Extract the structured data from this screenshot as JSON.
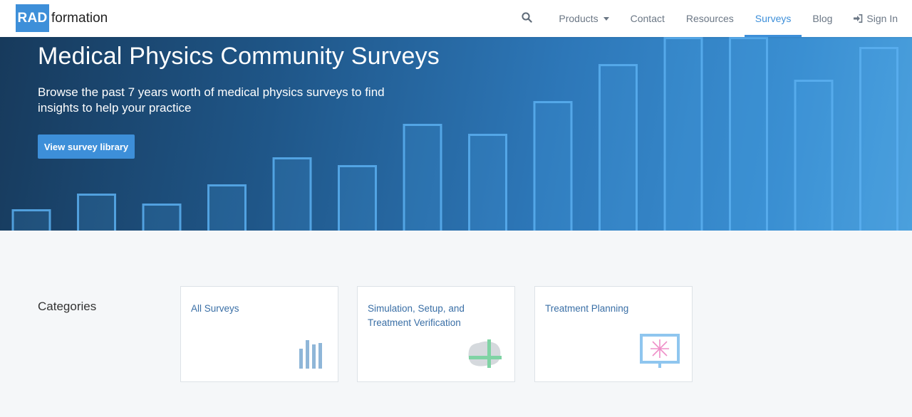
{
  "brand": {
    "logo_mark": "RAD",
    "logo_text": "formation",
    "accent": "#3d8fd9"
  },
  "nav": {
    "search_icon": "search-icon",
    "items": [
      {
        "label": "Products",
        "has_dropdown": true
      },
      {
        "label": "Contact"
      },
      {
        "label": "Resources"
      },
      {
        "label": "Surveys",
        "active": true
      },
      {
        "label": "Blog"
      }
    ],
    "signin": {
      "label": "Sign In",
      "icon": "sign-in-icon"
    }
  },
  "hero": {
    "title": "Medical Physics Community Surveys",
    "subtitle": "Browse the past 7 years worth of medical physics surveys to find insights to help your practice",
    "button_label": "View survey library",
    "bar_levels": [
      0.11,
      0.19,
      0.14,
      0.24,
      0.38,
      0.34,
      0.55,
      0.5,
      0.67,
      0.86,
      1.0,
      1.0,
      0.78,
      0.95,
      1.0
    ]
  },
  "categories": {
    "heading": "Categories",
    "cards": [
      {
        "title": "All Surveys",
        "icon": "bar-chart-icon"
      },
      {
        "title": "Simulation, Setup, and Treatment Verification",
        "icon": "crosshair-body-icon"
      },
      {
        "title": "Treatment Planning",
        "icon": "monitor-beam-icon"
      }
    ]
  }
}
